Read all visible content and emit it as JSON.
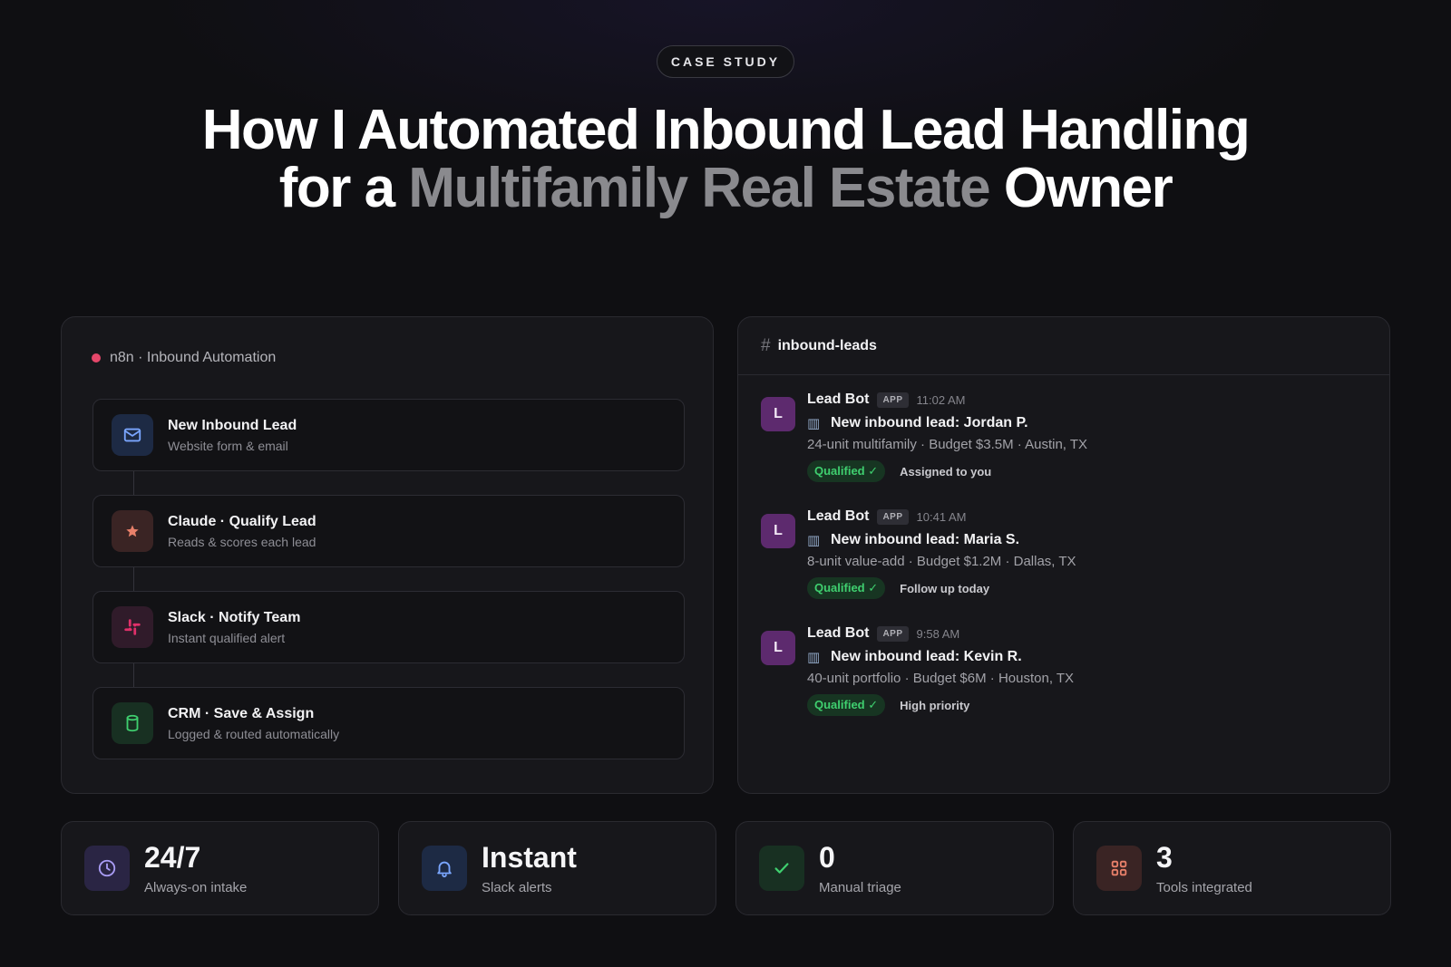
{
  "pill": "CASE STUDY",
  "title": {
    "line1": "How I Automated Inbound Lead Handling",
    "line2_pre": "for a ",
    "line2_muted": "Multifamily Real Estate",
    "line2_post": " Owner"
  },
  "flow": {
    "header": "n8n · Inbound Automation",
    "steps": [
      {
        "title": "New Inbound Lead",
        "sub": "Website form & email",
        "icon": "mail-icon"
      },
      {
        "title": "Claude · Qualify Lead",
        "sub": "Reads & scores each lead",
        "icon": "star-icon"
      },
      {
        "title": "Slack · Notify Team",
        "sub": "Instant qualified alert",
        "icon": "slack-icon"
      },
      {
        "title": "CRM · Save & Assign",
        "sub": "Logged & routed automatically",
        "icon": "database-icon"
      }
    ]
  },
  "slack": {
    "channel": "inbound-leads",
    "messages": [
      {
        "avatar": "L",
        "bot": "Lead Bot",
        "app": "APP",
        "time": "11:02 AM",
        "headline": "New inbound lead: Jordan P.",
        "details": "24-unit multifamily · Budget $3.5M · Austin, TX",
        "badge": "Qualified ✓",
        "tag": "Assigned to you"
      },
      {
        "avatar": "L",
        "bot": "Lead Bot",
        "app": "APP",
        "time": "10:41 AM",
        "headline": "New inbound lead: Maria S.",
        "details": "8-unit value-add · Budget $1.2M · Dallas, TX",
        "badge": "Qualified ✓",
        "tag": "Follow up today"
      },
      {
        "avatar": "L",
        "bot": "Lead Bot",
        "app": "APP",
        "time": "9:58 AM",
        "headline": "New inbound lead: Kevin R.",
        "details": "40-unit portfolio · Budget $6M · Houston, TX",
        "badge": "Qualified ✓",
        "tag": "High priority"
      }
    ]
  },
  "stats": [
    {
      "value": "24/7",
      "label": "Always-on intake",
      "icon": "clock-icon"
    },
    {
      "value": "Instant",
      "label": "Slack alerts",
      "icon": "bell-icon"
    },
    {
      "value": "0",
      "label": "Manual triage",
      "icon": "check-icon"
    },
    {
      "value": "3",
      "label": "Tools integrated",
      "icon": "grid-icon"
    }
  ],
  "colors": {
    "background": "#0f0f12",
    "card": "#17171b",
    "accent_red": "#e5476a",
    "qualified_green": "#3fcf6f",
    "avatar_purple": "#5d2a6e"
  }
}
